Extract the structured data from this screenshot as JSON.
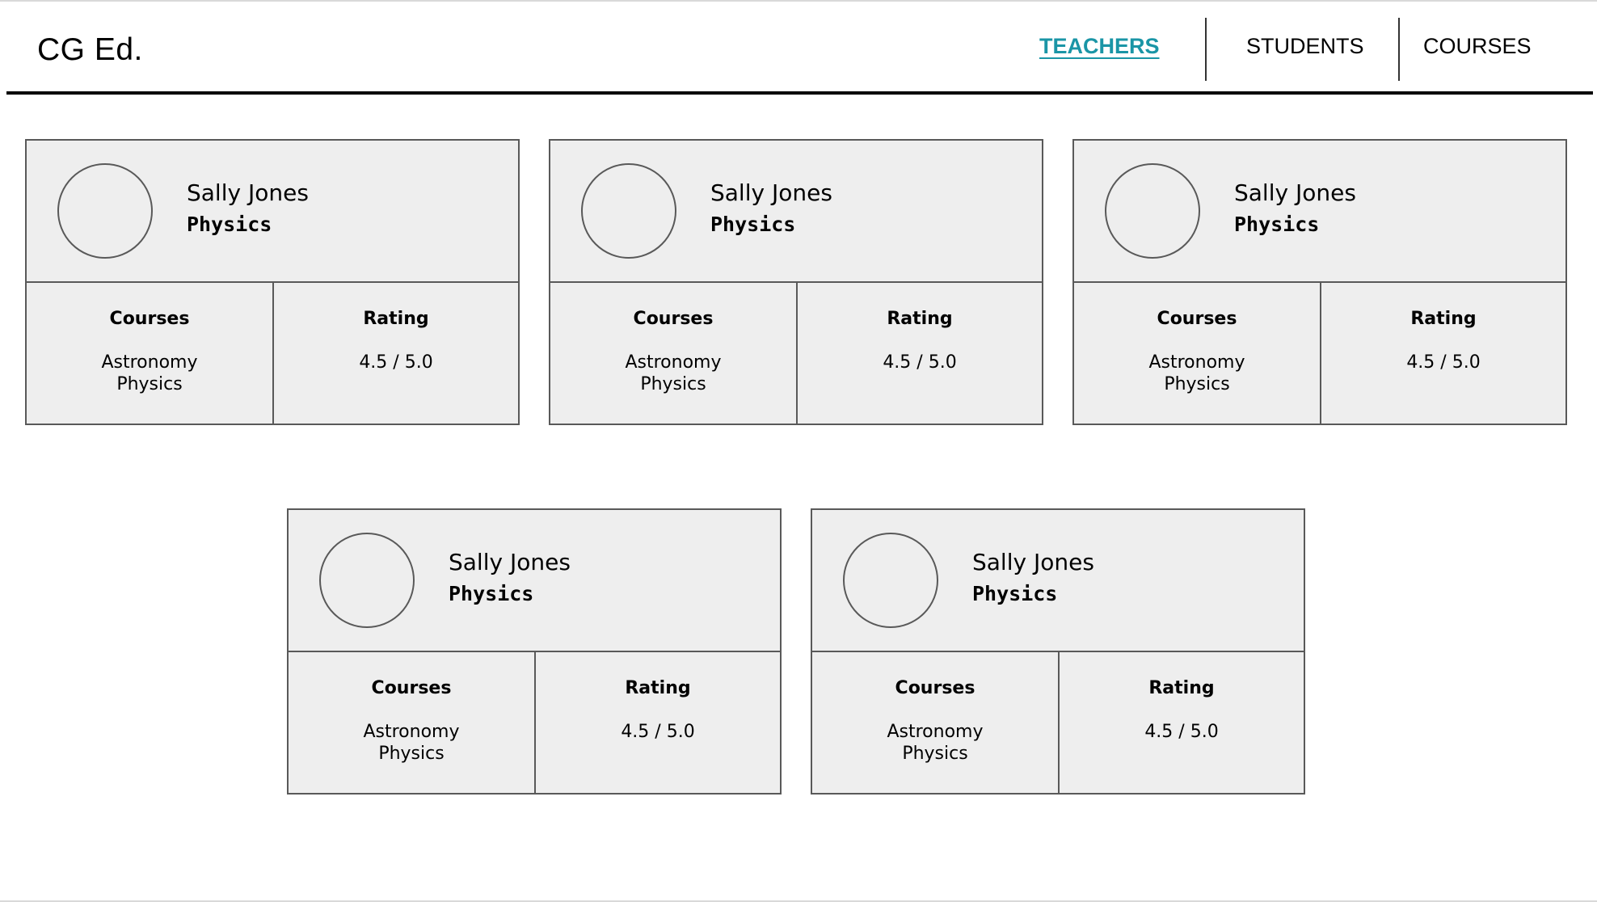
{
  "header": {
    "logo": "CG Ed.",
    "nav": [
      {
        "label": "TEACHERS",
        "active": true
      },
      {
        "label": "STUDENTS",
        "active": false
      },
      {
        "label": "COURSES",
        "active": false
      }
    ],
    "active_color": "#1a95a6"
  },
  "cards_section": {
    "course_heading": "Courses",
    "rating_heading": "Rating"
  },
  "teachers": [
    {
      "name": "Sally Jones",
      "subject": "Physics",
      "courses": [
        "Astronomy",
        "Physics"
      ],
      "rating": "4.5 / 5.0"
    },
    {
      "name": "Sally Jones",
      "subject": "Physics",
      "courses": [
        "Astronomy",
        "Physics"
      ],
      "rating": "4.5 / 5.0"
    },
    {
      "name": "Sally Jones",
      "subject": "Physics",
      "courses": [
        "Astronomy",
        "Physics"
      ],
      "rating": "4.5 / 5.0"
    },
    {
      "name": "Sally Jones",
      "subject": "Physics",
      "courses": [
        "Astronomy",
        "Physics"
      ],
      "rating": "4.5 / 5.0"
    },
    {
      "name": "Sally Jones",
      "subject": "Physics",
      "courses": [
        "Astronomy",
        "Physics"
      ],
      "rating": "4.5 / 5.0"
    }
  ]
}
